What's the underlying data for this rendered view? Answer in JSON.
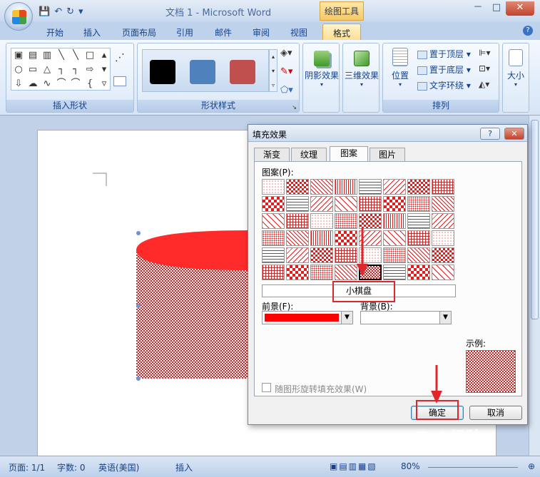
{
  "window": {
    "title": "文档 1 - Microsoft Word",
    "context_tab": "绘图工具",
    "controls": [
      "－",
      "□",
      "✕"
    ]
  },
  "quick_access": [
    "💾",
    "↶",
    "↻",
    "▾"
  ],
  "tabs": [
    "开始",
    "插入",
    "页面布局",
    "引用",
    "邮件",
    "审阅",
    "视图",
    "格式"
  ],
  "active_tab": "格式",
  "ribbon": {
    "groups": {
      "insert_shapes": "插入形状",
      "shape_styles": "形状样式",
      "shadow": "阴影效果",
      "three_d": "三维效果",
      "arrange": "排列",
      "size": "大小"
    },
    "shape_glyphs": [
      "▣",
      "▤",
      "▥",
      "╲",
      "╲",
      "□",
      "",
      "○",
      "▭",
      "△",
      "┐",
      "┐",
      "⇨",
      "",
      "⇩",
      "☁",
      "∿",
      "⌒",
      "⌒",
      "{",
      "",
      ""
    ],
    "swatch_colors": [
      "#000000",
      "#4f81bd",
      "#c0504d"
    ],
    "arrange_buttons": {
      "position": "位置",
      "bring_to_front": "置于顶层",
      "send_to_back": "置于底层",
      "text_wrap": "文字环绕"
    }
  },
  "dialog": {
    "title": "填充效果",
    "help_button": "?",
    "close_button": "✕",
    "tabs": [
      "渐变",
      "纹理",
      "图案",
      "图片"
    ],
    "active_tab": "图案",
    "pattern_label": "图案(P):",
    "selected_pattern_name": "小棋盘",
    "foreground_label": "前景(F):",
    "background_label": "背景(B):",
    "foreground_color": "#ff0000",
    "pattern_color": "#e51c1c",
    "sample_label": "示例:",
    "rotate_checkbox_label": "随图形旋转填充效果(W)",
    "ok_button": "确定",
    "cancel_button": "取消"
  },
  "status_bar": {
    "page": "页面: 1/1",
    "words": "字数: 0",
    "language": "英语(美国)",
    "insert_mode": "插入",
    "zoom": "80%"
  },
  "watermark": "Bai 经验"
}
